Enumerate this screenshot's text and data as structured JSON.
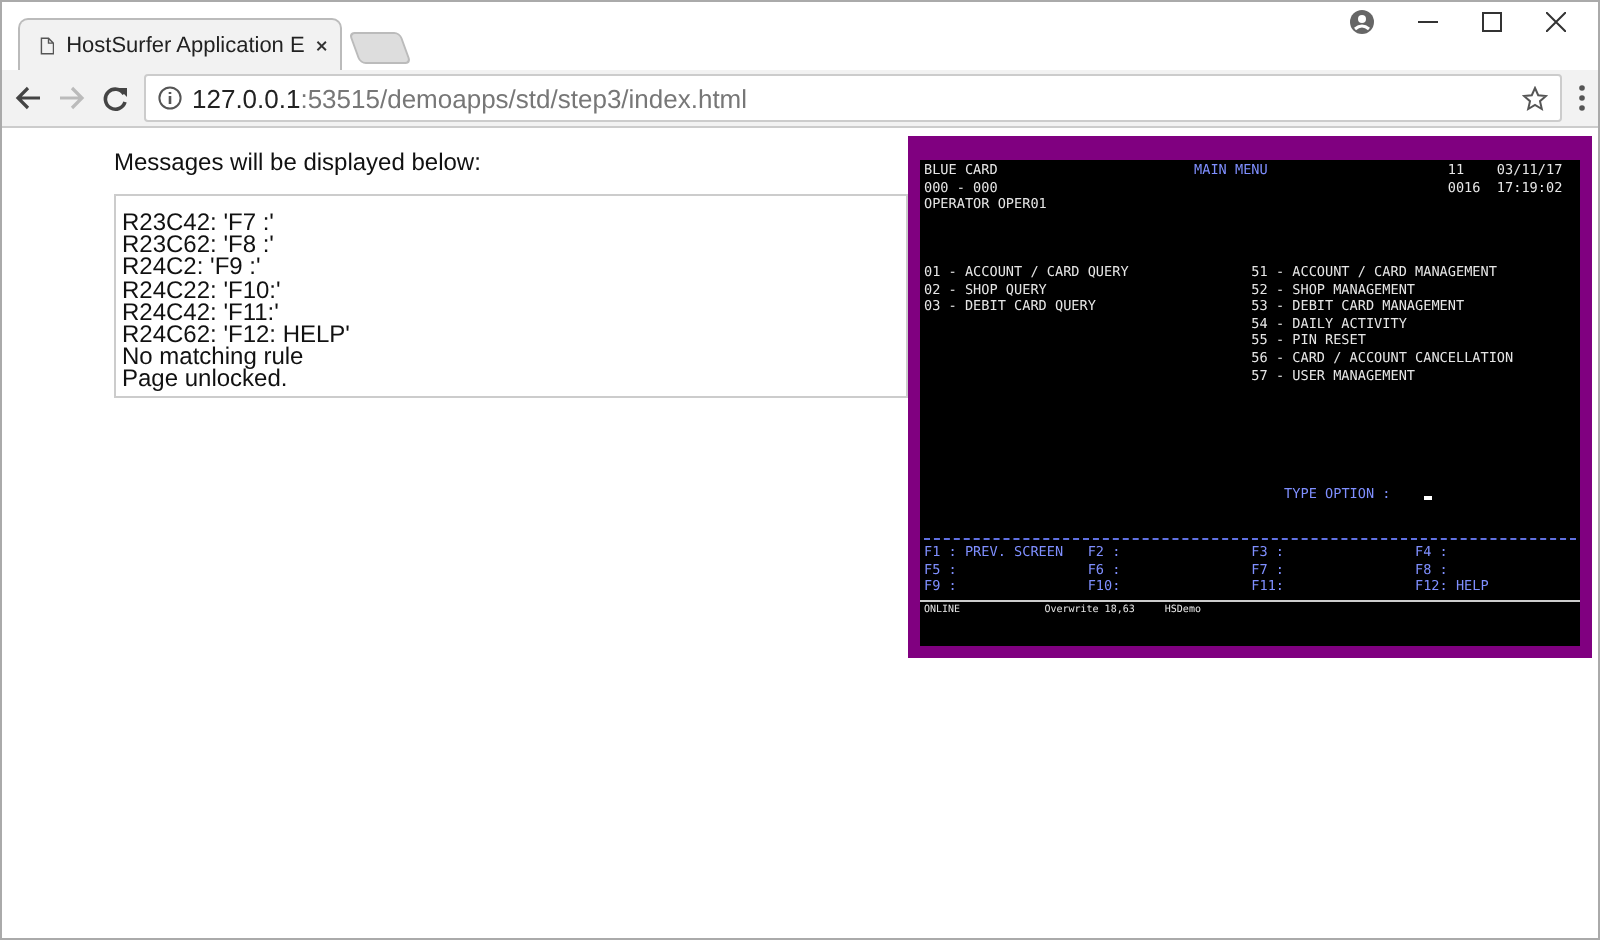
{
  "browser": {
    "tabs": [
      {
        "title": "HostSurfer Application E",
        "selected": true
      }
    ],
    "address": {
      "host": "127.0.0.1",
      "path": ":53515/demoapps/std/step3/index.html"
    }
  },
  "messages": {
    "label": "Messages will be displayed below:",
    "lines": [
      "R23C42: 'F7 :'",
      "R23C62: 'F8 :'",
      "R24C2: 'F9 :'",
      "R24C22: 'F10:'",
      "R24C42: 'F11:'",
      "R24C62: 'F12: HELP'",
      "No matching rule",
      "Page unlocked."
    ]
  },
  "terminal": {
    "header_left": [
      "BLUE CARD",
      "000 - 000",
      "OPERATOR OPER01"
    ],
    "title": "MAIN MENU",
    "header_right": [
      "11    03/11/17",
      "0016  17:19:02"
    ],
    "menu_left": [
      "01 - ACCOUNT / CARD QUERY",
      "02 - SHOP QUERY",
      "03 - DEBIT CARD QUERY"
    ],
    "menu_right": [
      "51 - ACCOUNT / CARD MANAGEMENT",
      "52 - SHOP MANAGEMENT",
      "53 - DEBIT CARD MANAGEMENT",
      "54 - DAILY ACTIVITY",
      "55 - PIN RESET",
      "56 - CARD / ACCOUNT CANCELLATION",
      "57 - USER MANAGEMENT"
    ],
    "prompt": "TYPE OPTION :",
    "function_keys": [
      "F1 : PREV. SCREEN",
      "F2 :",
      "F3 :",
      "F4 :",
      "F5 :",
      "F6 :",
      "F7 :",
      "F8 :",
      "F9 :",
      "F10:",
      "F11:",
      "F12: HELP"
    ],
    "status": [
      "ONLINE",
      "Overwrite 18,63",
      "HSDemo"
    ]
  }
}
